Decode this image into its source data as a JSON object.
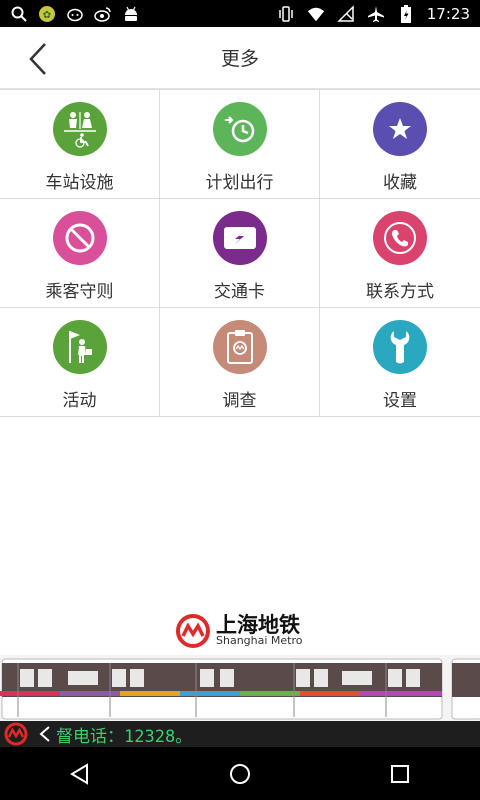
{
  "status_bar": {
    "time": "17:23",
    "left_icons": [
      "search-icon",
      "app-icon",
      "cat-icon",
      "weibo-icon",
      "android-icon"
    ],
    "right_icons": [
      "vibrate-icon",
      "wifi-icon",
      "no-signal-icon",
      "airplane-icon",
      "battery-icon"
    ]
  },
  "header": {
    "title": "更多"
  },
  "grid": {
    "items": [
      {
        "label": "车站设施",
        "icon": "facilities-icon",
        "color": "#5aa33a"
      },
      {
        "label": "计划出行",
        "icon": "plan-trip-icon",
        "color": "#5db55a"
      },
      {
        "label": "收藏",
        "icon": "star-icon",
        "color": "#5a4fb0"
      },
      {
        "label": "乘客守则",
        "icon": "prohibited-icon",
        "color": "#d94f9a"
      },
      {
        "label": "交通卡",
        "icon": "transit-card-icon",
        "color": "#7a2b8c"
      },
      {
        "label": "联系方式",
        "icon": "phone-icon",
        "color": "#d9436e"
      },
      {
        "label": "活动",
        "icon": "activity-flag-icon",
        "color": "#5aa33a"
      },
      {
        "label": "调查",
        "icon": "survey-clipboard-icon",
        "color": "#c58a78"
      },
      {
        "label": "设置",
        "icon": "wrench-icon",
        "color": "#29a8bf"
      }
    ]
  },
  "logo": {
    "cn": "上海地铁",
    "en": "Shanghai Metro"
  },
  "ticker": {
    "text": "督电话：12328。"
  },
  "navbar": {
    "icons": [
      "back-triangle-icon",
      "home-circle-icon",
      "recents-square-icon"
    ]
  }
}
